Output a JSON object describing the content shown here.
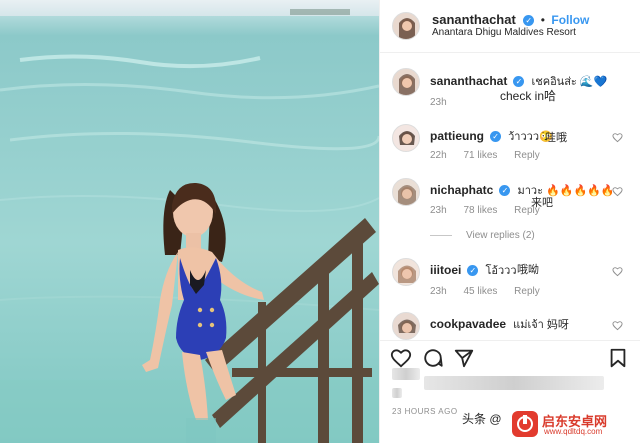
{
  "post": {
    "header": {
      "username": "sananthachat",
      "follow_label": "Follow",
      "location": "Anantara Dhigu Maldives Resort"
    },
    "caption": {
      "username": "sananthachat",
      "text": "เชคอินส่ะ",
      "emoji": "🌊💙",
      "translation": "check in哈",
      "time": "23h"
    },
    "comments": [
      {
        "username": "pattieung",
        "text": "ว้าววว😳",
        "translation": "哇哦",
        "time": "22h",
        "likes": "71 likes",
        "reply": "Reply"
      },
      {
        "username": "nichaphatc",
        "text": "มาวะ 🔥🔥🔥🔥🔥",
        "translation": "来吧",
        "time": "23h",
        "likes": "78 likes",
        "reply": "Reply"
      },
      {
        "username": "iiitoei",
        "text": "โอ้ววว",
        "translation": "哦呦",
        "time": "23h",
        "likes": "45 likes",
        "reply": "Reply"
      },
      {
        "username": "cookpavadee",
        "text": "แม่เจ้า",
        "translation": "妈呀"
      }
    ],
    "view_replies": "View replies (2)",
    "time_ago": "23 HOURS AGO",
    "add_comment_partial": "头条 @"
  },
  "watermark": {
    "title": "启东安卓网",
    "url": "www.qdltdq.com"
  },
  "colors": {
    "link_blue": "#3897f0",
    "text_dark": "#262626",
    "text_gray": "#8e8e8e",
    "swimsuit": "#2c3fb6",
    "water": "#8fd0cf"
  },
  "icons": [
    "verified-badge-icon",
    "heart-icon",
    "comment-icon",
    "share-icon",
    "bookmark-icon"
  ]
}
